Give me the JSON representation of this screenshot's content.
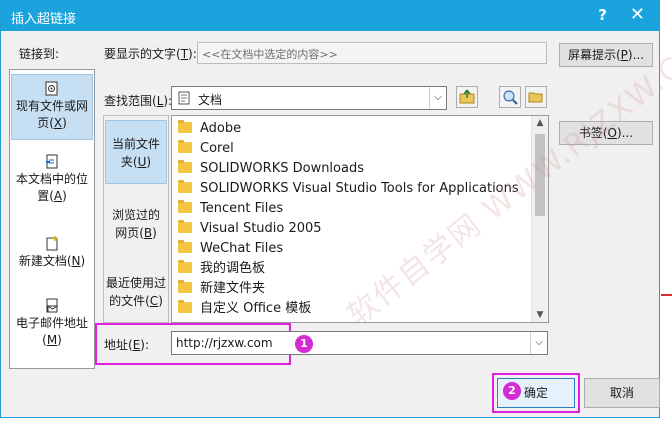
{
  "window": {
    "title": "插入超链接",
    "help": "?",
    "close": "✕"
  },
  "link_to": {
    "label": "链接到:",
    "items": [
      {
        "line1": "现有文件或网",
        "line2": "页(",
        "key": "X",
        "end": ")",
        "selected": true
      },
      {
        "line1": "本文档中的位",
        "line2": "置(",
        "key": "A",
        "end": ")",
        "selected": false
      },
      {
        "line1": "新建文档(",
        "line2": "",
        "key": "N",
        "end": ")",
        "selected": false
      },
      {
        "line1": "电子邮件地址",
        "line2": "(",
        "key": "M",
        "end": ")",
        "selected": false
      }
    ]
  },
  "display_text": {
    "label": "要显示的文字(",
    "key": "T",
    "end": "):",
    "value": "<<在文档中选定的内容>>"
  },
  "screentip_button": {
    "label": "屏幕提示(",
    "key": "P",
    "end": ")..."
  },
  "look_in": {
    "label": "查找范围(",
    "key": "L",
    "end": "):",
    "value": "文档"
  },
  "bookmark_button": {
    "label": "书签(",
    "key": "O",
    "end": ")..."
  },
  "browse": {
    "items": [
      {
        "line1": "当前文件",
        "line2": "夹(",
        "key": "U",
        "end": ")",
        "selected": true
      },
      {
        "line1": "浏览过的",
        "line2": "网页(",
        "key": "B",
        "end": ")",
        "selected": false
      },
      {
        "line1": "最近使用过",
        "line2": "的文件(",
        "key": "C",
        "end": ")",
        "selected": false
      }
    ]
  },
  "files": [
    "Adobe",
    "Corel",
    "SOLIDWORKS Downloads",
    "SOLIDWORKS Visual Studio Tools for Applications",
    "Tencent Files",
    "Visual Studio 2005",
    "WeChat Files",
    "我的调色板",
    "新建文件夹",
    "自定义 Office 模板"
  ],
  "address": {
    "label": "地址(",
    "key": "E",
    "end": "):",
    "value": "http://rjzxw.com"
  },
  "ok_button": {
    "label": "确定"
  },
  "cancel_button": {
    "label": "取消"
  },
  "annotations": {
    "step1": "1",
    "step2": "2"
  },
  "watermark": "软件自学网 WWW.RJZXW.COM",
  "colors": {
    "titlebar": "#1aa3dc",
    "highlight": "#e21ee0",
    "selection": "#c6dff3"
  }
}
